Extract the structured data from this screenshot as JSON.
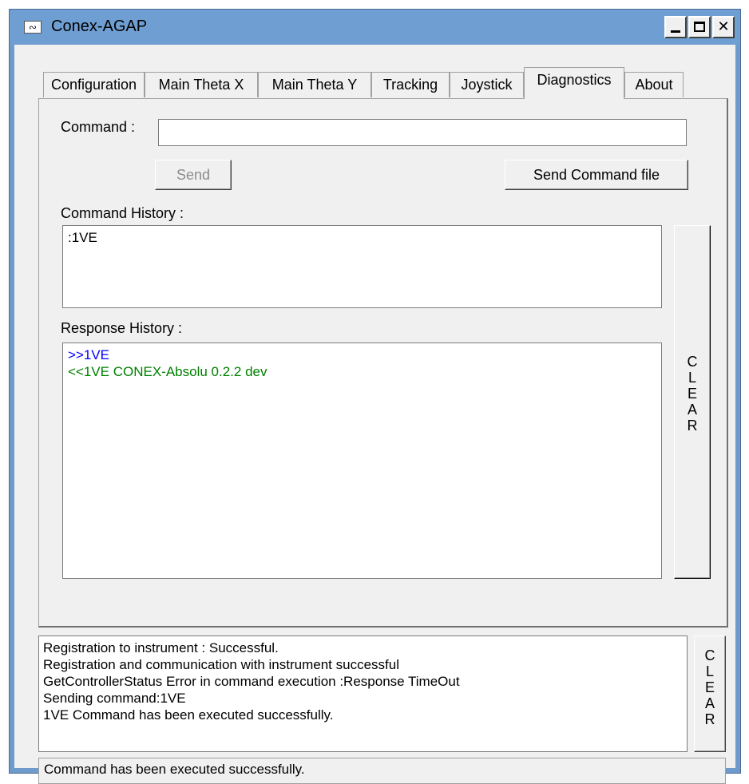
{
  "window": {
    "title": "Conex-AGAP"
  },
  "tabs": [
    {
      "label": "Configuration"
    },
    {
      "label": "Main Theta X"
    },
    {
      "label": "Main Theta Y"
    },
    {
      "label": "Tracking"
    },
    {
      "label": "Joystick"
    },
    {
      "label": "Diagnostics",
      "selected": true
    },
    {
      "label": "About"
    }
  ],
  "diagnostics": {
    "command_label": "Command :",
    "command_value": "",
    "send_label": "Send",
    "send_file_label": "Send Command file",
    "command_history_label": "Command History :",
    "command_history_lines": [
      ":1VE"
    ],
    "response_history_label": "Response History :",
    "response_lines": [
      {
        "text": ">>1VE",
        "color": "#0000ff"
      },
      {
        "text": "<<1VE CONEX-Absolu  0.2.2 dev",
        "color": "#008000"
      }
    ],
    "clear_letters": [
      "C",
      "L",
      "E",
      "A",
      "R"
    ]
  },
  "log": {
    "lines": [
      "Registration to instrument : Successful.",
      "Registration and communication with instrument successful",
      "GetControllerStatus Error in command execution :Response TimeOut",
      "Sending command:1VE",
      "1VE Command has been executed successfully."
    ],
    "clear_letters": [
      "C",
      "L",
      "E",
      "A",
      "R"
    ]
  },
  "status": {
    "text": "Command has been executed successfully."
  }
}
